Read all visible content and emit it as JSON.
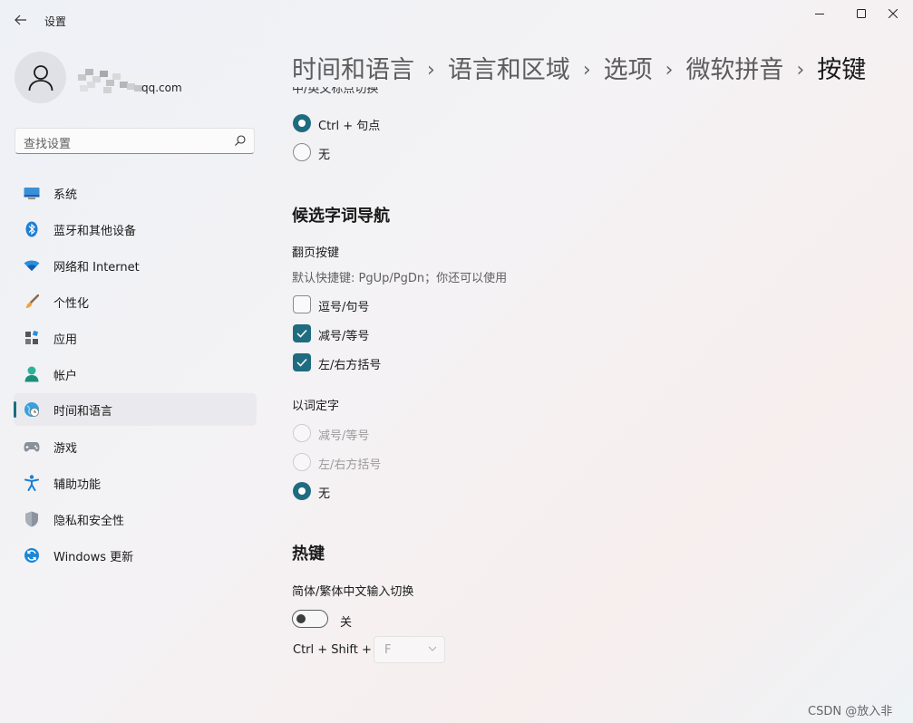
{
  "window": {
    "title": "设置",
    "minimize_glyph": "—",
    "maximize_glyph": "☐",
    "close_glyph": "✕"
  },
  "profile": {
    "email_suffix": "qq.com"
  },
  "search": {
    "placeholder": "查找设置"
  },
  "nav": {
    "items": [
      {
        "label": "系统",
        "icon": "monitor-icon"
      },
      {
        "label": "蓝牙和其他设备",
        "icon": "bluetooth-icon"
      },
      {
        "label": "网络和 Internet",
        "icon": "wifi-icon"
      },
      {
        "label": "个性化",
        "icon": "brush-icon"
      },
      {
        "label": "应用",
        "icon": "apps-icon"
      },
      {
        "label": "帐户",
        "icon": "person-icon"
      },
      {
        "label": "时间和语言",
        "icon": "clock-globe-icon",
        "active": true
      },
      {
        "label": "游戏",
        "icon": "gamepad-icon"
      },
      {
        "label": "辅助功能",
        "icon": "accessibility-icon"
      },
      {
        "label": "隐私和安全性",
        "icon": "shield-icon"
      },
      {
        "label": "Windows 更新",
        "icon": "update-icon"
      }
    ]
  },
  "breadcrumb": {
    "items": [
      "时间和语言",
      "语言和区域",
      "选项",
      "微软拼音",
      "按键"
    ],
    "separator": "›"
  },
  "top_section": {
    "clipped_label": "中/英文标点切换",
    "options": [
      {
        "label": "Ctrl + 句点",
        "selected": true
      },
      {
        "label": "无",
        "selected": false
      }
    ]
  },
  "candidate_nav": {
    "title": "候选字词导航",
    "page_keys_label": "翻页按键",
    "page_keys_hint": "默认快捷键: PgUp/PgDn；你还可以使用",
    "checkboxes": [
      {
        "label": "逗号/句号",
        "checked": false
      },
      {
        "label": "减号/等号",
        "checked": true
      },
      {
        "label": "左/右方括号",
        "checked": true
      }
    ],
    "select_char_label": "以词定字",
    "radios": [
      {
        "label": "减号/等号",
        "selected": false,
        "disabled": true
      },
      {
        "label": "左/右方括号",
        "selected": false,
        "disabled": true
      },
      {
        "label": "无",
        "selected": true,
        "disabled": false
      }
    ]
  },
  "hotkeys": {
    "title": "热键",
    "switch_label": "简体/繁体中文输入切换",
    "toggle_state": "关",
    "toggle_on": false,
    "shortcut_prefix": "Ctrl + Shift +",
    "shortcut_key": "F"
  },
  "watermark": "CSDN @放入非",
  "colors": {
    "accent": "#1f6c80"
  }
}
